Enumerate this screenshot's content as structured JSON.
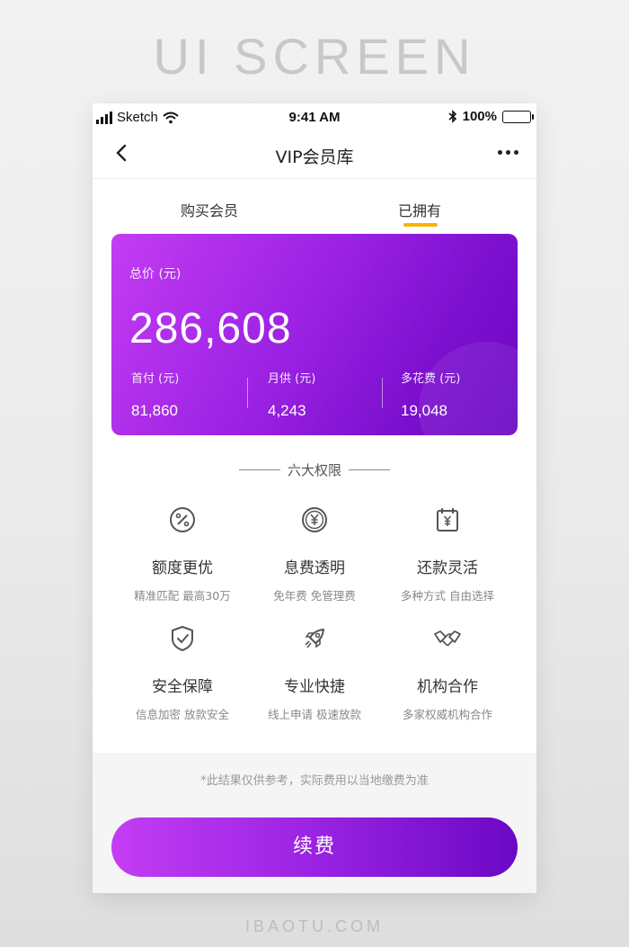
{
  "showcase": {
    "title": "UI SCREEN",
    "footer": "IBAOTU.COM"
  },
  "status_bar": {
    "carrier": "Sketch",
    "time": "9:41 AM",
    "battery": "100%",
    "battery_level": 1.0
  },
  "nav": {
    "title": "VIP会员库",
    "back_icon": "chevron-left-icon",
    "more_icon": "more-horizontal-icon"
  },
  "tabs": [
    {
      "label": "购买会员",
      "active": false
    },
    {
      "label": "已拥有",
      "active": true
    }
  ],
  "colors": {
    "accent": "#f5b400",
    "card_start": "#c43cf2",
    "card_end": "#6a08c3",
    "button_start": "#c33df3",
    "button_end": "#6b08c4"
  },
  "card": {
    "total_label": "总价 (元)",
    "total_value": "286,608",
    "items": [
      {
        "label": "首付 (元)",
        "value": "81,860"
      },
      {
        "label": "月供 (元)",
        "value": "4,243"
      },
      {
        "label": "多花费 (元)",
        "value": "19,048"
      }
    ]
  },
  "section": {
    "title": "六大权限"
  },
  "features": [
    {
      "icon": "percent-icon",
      "title": "额度更优",
      "desc": "精准匹配 最高30万"
    },
    {
      "icon": "yuan-coin-icon",
      "title": "息费透明",
      "desc": "免年费 免管理费"
    },
    {
      "icon": "calendar-yuan-icon",
      "title": "还款灵活",
      "desc": "多种方式 自由选择"
    },
    {
      "icon": "shield-check-icon",
      "title": "安全保障",
      "desc": "信息加密 放款安全"
    },
    {
      "icon": "rocket-icon",
      "title": "专业快捷",
      "desc": "线上申请 极速放款"
    },
    {
      "icon": "handshake-icon",
      "title": "机构合作",
      "desc": "多家权威机构合作"
    }
  ],
  "disclaimer": "*此结果仅供参考，实际费用以当地缴费为准",
  "renew_button": "续费"
}
